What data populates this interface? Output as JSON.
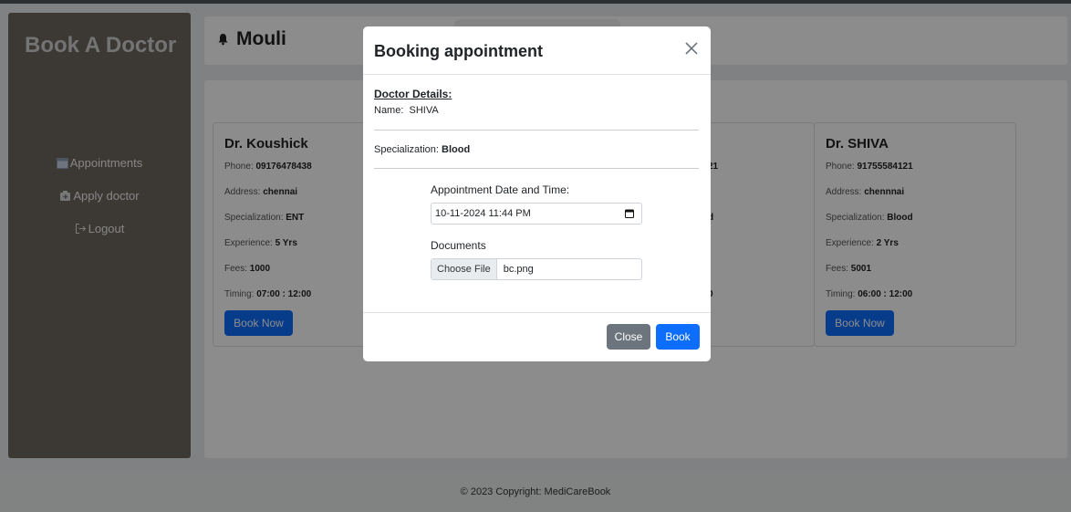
{
  "brand": "Book A Doctor",
  "nav": {
    "appointments": "Appointments",
    "apply_doctor": "Apply doctor",
    "logout": "Logout"
  },
  "header": {
    "user": "Mouli"
  },
  "cards": [
    {
      "name": "Dr. Koushick",
      "phone_label": "Phone:",
      "phone": "09176478438",
      "address_label": "Address:",
      "address": "chennai",
      "spec_label": "Specialization:",
      "spec": "ENT",
      "exp_label": "Experience:",
      "exp": "5 Yrs",
      "fees_label": "Fees:",
      "fees": "1000",
      "timing_label": "Timing:",
      "timing": "07:00 : 12:00",
      "button": "Book Now"
    },
    {
      "phone_partial": "21",
      "spec_partial": "d",
      "timing_partial": "0"
    },
    {
      "name": "Dr. SHIVA",
      "phone_label": "Phone:",
      "phone": "91755584121",
      "address_label": "Address:",
      "address": "chennnai",
      "spec_label": "Specialization:",
      "spec": "Blood",
      "exp_label": "Experience:",
      "exp": "2 Yrs",
      "fees_label": "Fees:",
      "fees": "5001",
      "timing_label": "Timing:",
      "timing": "06:00 : 12:00",
      "button": "Book Now"
    }
  ],
  "footer": "© 2023 Copyright: MediCareBook",
  "modal": {
    "title": "Booking appointment",
    "doctor_details_heading": "Doctor Details:",
    "name_line": "Name:  SHIVA",
    "spec_label": "Specialization:",
    "spec_value": "Blood",
    "date_label": "Appointment Date and Time:",
    "date_value": "10-11-2024 11:44 PM",
    "docs_label": "Documents",
    "choose_file": "Choose File",
    "file_name": "bc.png",
    "close_button": "Close",
    "book_button": "Book"
  },
  "colors": {
    "primary": "#0d6efd",
    "secondary": "#6c757d",
    "sidebar": "#6e6660"
  }
}
